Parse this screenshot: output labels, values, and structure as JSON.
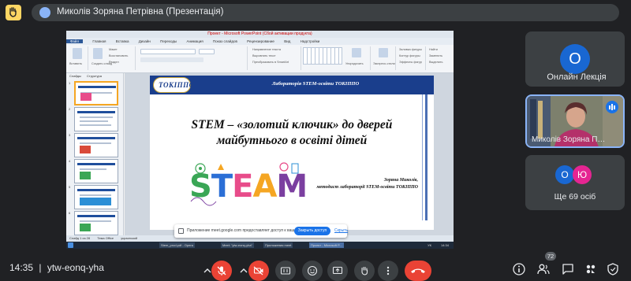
{
  "top_bar": {
    "presentation_label": "Миколів Зоряна Петрівна (Презентація)"
  },
  "shared_screen": {
    "window_title": "Проект - Microsoft PowerPoint (Сбой активации продукта)",
    "ribbon_tabs": [
      "Файл",
      "Главная",
      "Вставка",
      "Дизайн",
      "Переходы",
      "Анимация",
      "Показ слайдов",
      "Рецензирование",
      "Вид",
      "Надстройки"
    ],
    "ribbon": {
      "paste": "Вставить",
      "new_slide": "Создать слайд",
      "layout": "Макет",
      "restore": "Восстановить",
      "section": "Раздел",
      "text_direction": "Направление текста",
      "align_text": "Выровнять текст",
      "to_smartart": "Преобразовать в SmartArt",
      "arrange": "Упорядочить",
      "quick_styles": "Экспресс-стили",
      "shape_fill": "Заливка фигуры",
      "shape_outline": "Контур фигуры",
      "shape_effects": "Эффекты фигур",
      "find": "Найти",
      "replace": "Заменить",
      "select": "Выделить"
    },
    "pane_tabs": [
      "Слайды",
      "Структура"
    ],
    "slide_numbers": [
      "1",
      "2",
      "3",
      "4",
      "5",
      "6"
    ],
    "slide": {
      "logo": "ТОКІППО",
      "header": "Лабораторія STEM-освіти ТОКІППО",
      "title_line1": "STEM – «золотий ключик» до дверей",
      "title_line2": "майбутнього в освіті дітей",
      "steam_word": "STEAM",
      "author_name": "Зоряна Миколів,",
      "author_role": "методист лабораторії STEM-освіти ТОКІППО"
    },
    "status": {
      "slide_counter": "Слайд 1 из 28",
      "theme": "Тема Office",
      "language": "украинский"
    },
    "taskbar_items": [
      "Stem_prod.pdf - Opera",
      "Meet: \"ytw-eonq-yha\"",
      "Приложения meet",
      "Проект - Microsoft P..."
    ],
    "taskbar_clock": "14:34",
    "taskbar_lang": "УК"
  },
  "share_banner": {
    "message": "Приложение meet.google.com предоставляет доступ к вашему экрану.",
    "stop_button": "Закрыть доступ",
    "hide_link": "Скрыть"
  },
  "participants": {
    "online_lecture": {
      "initial": "О",
      "name": "Онлайн Лекція"
    },
    "presenter": {
      "name": "Миколів Зоряна Петрів..."
    },
    "others": {
      "initials": [
        "О",
        "Ю"
      ],
      "label": "Ще 69 осіб"
    }
  },
  "bottom_bar": {
    "time": "14:35",
    "meeting_code": "ytw-eonq-yha",
    "participants_count": "72"
  },
  "colors": {
    "meet_bg": "#202124",
    "control_gray": "#3c4043",
    "control_red": "#ea4335",
    "accent_blue": "#8ab4f8",
    "slide_header_blue": "#1a3e8c"
  }
}
